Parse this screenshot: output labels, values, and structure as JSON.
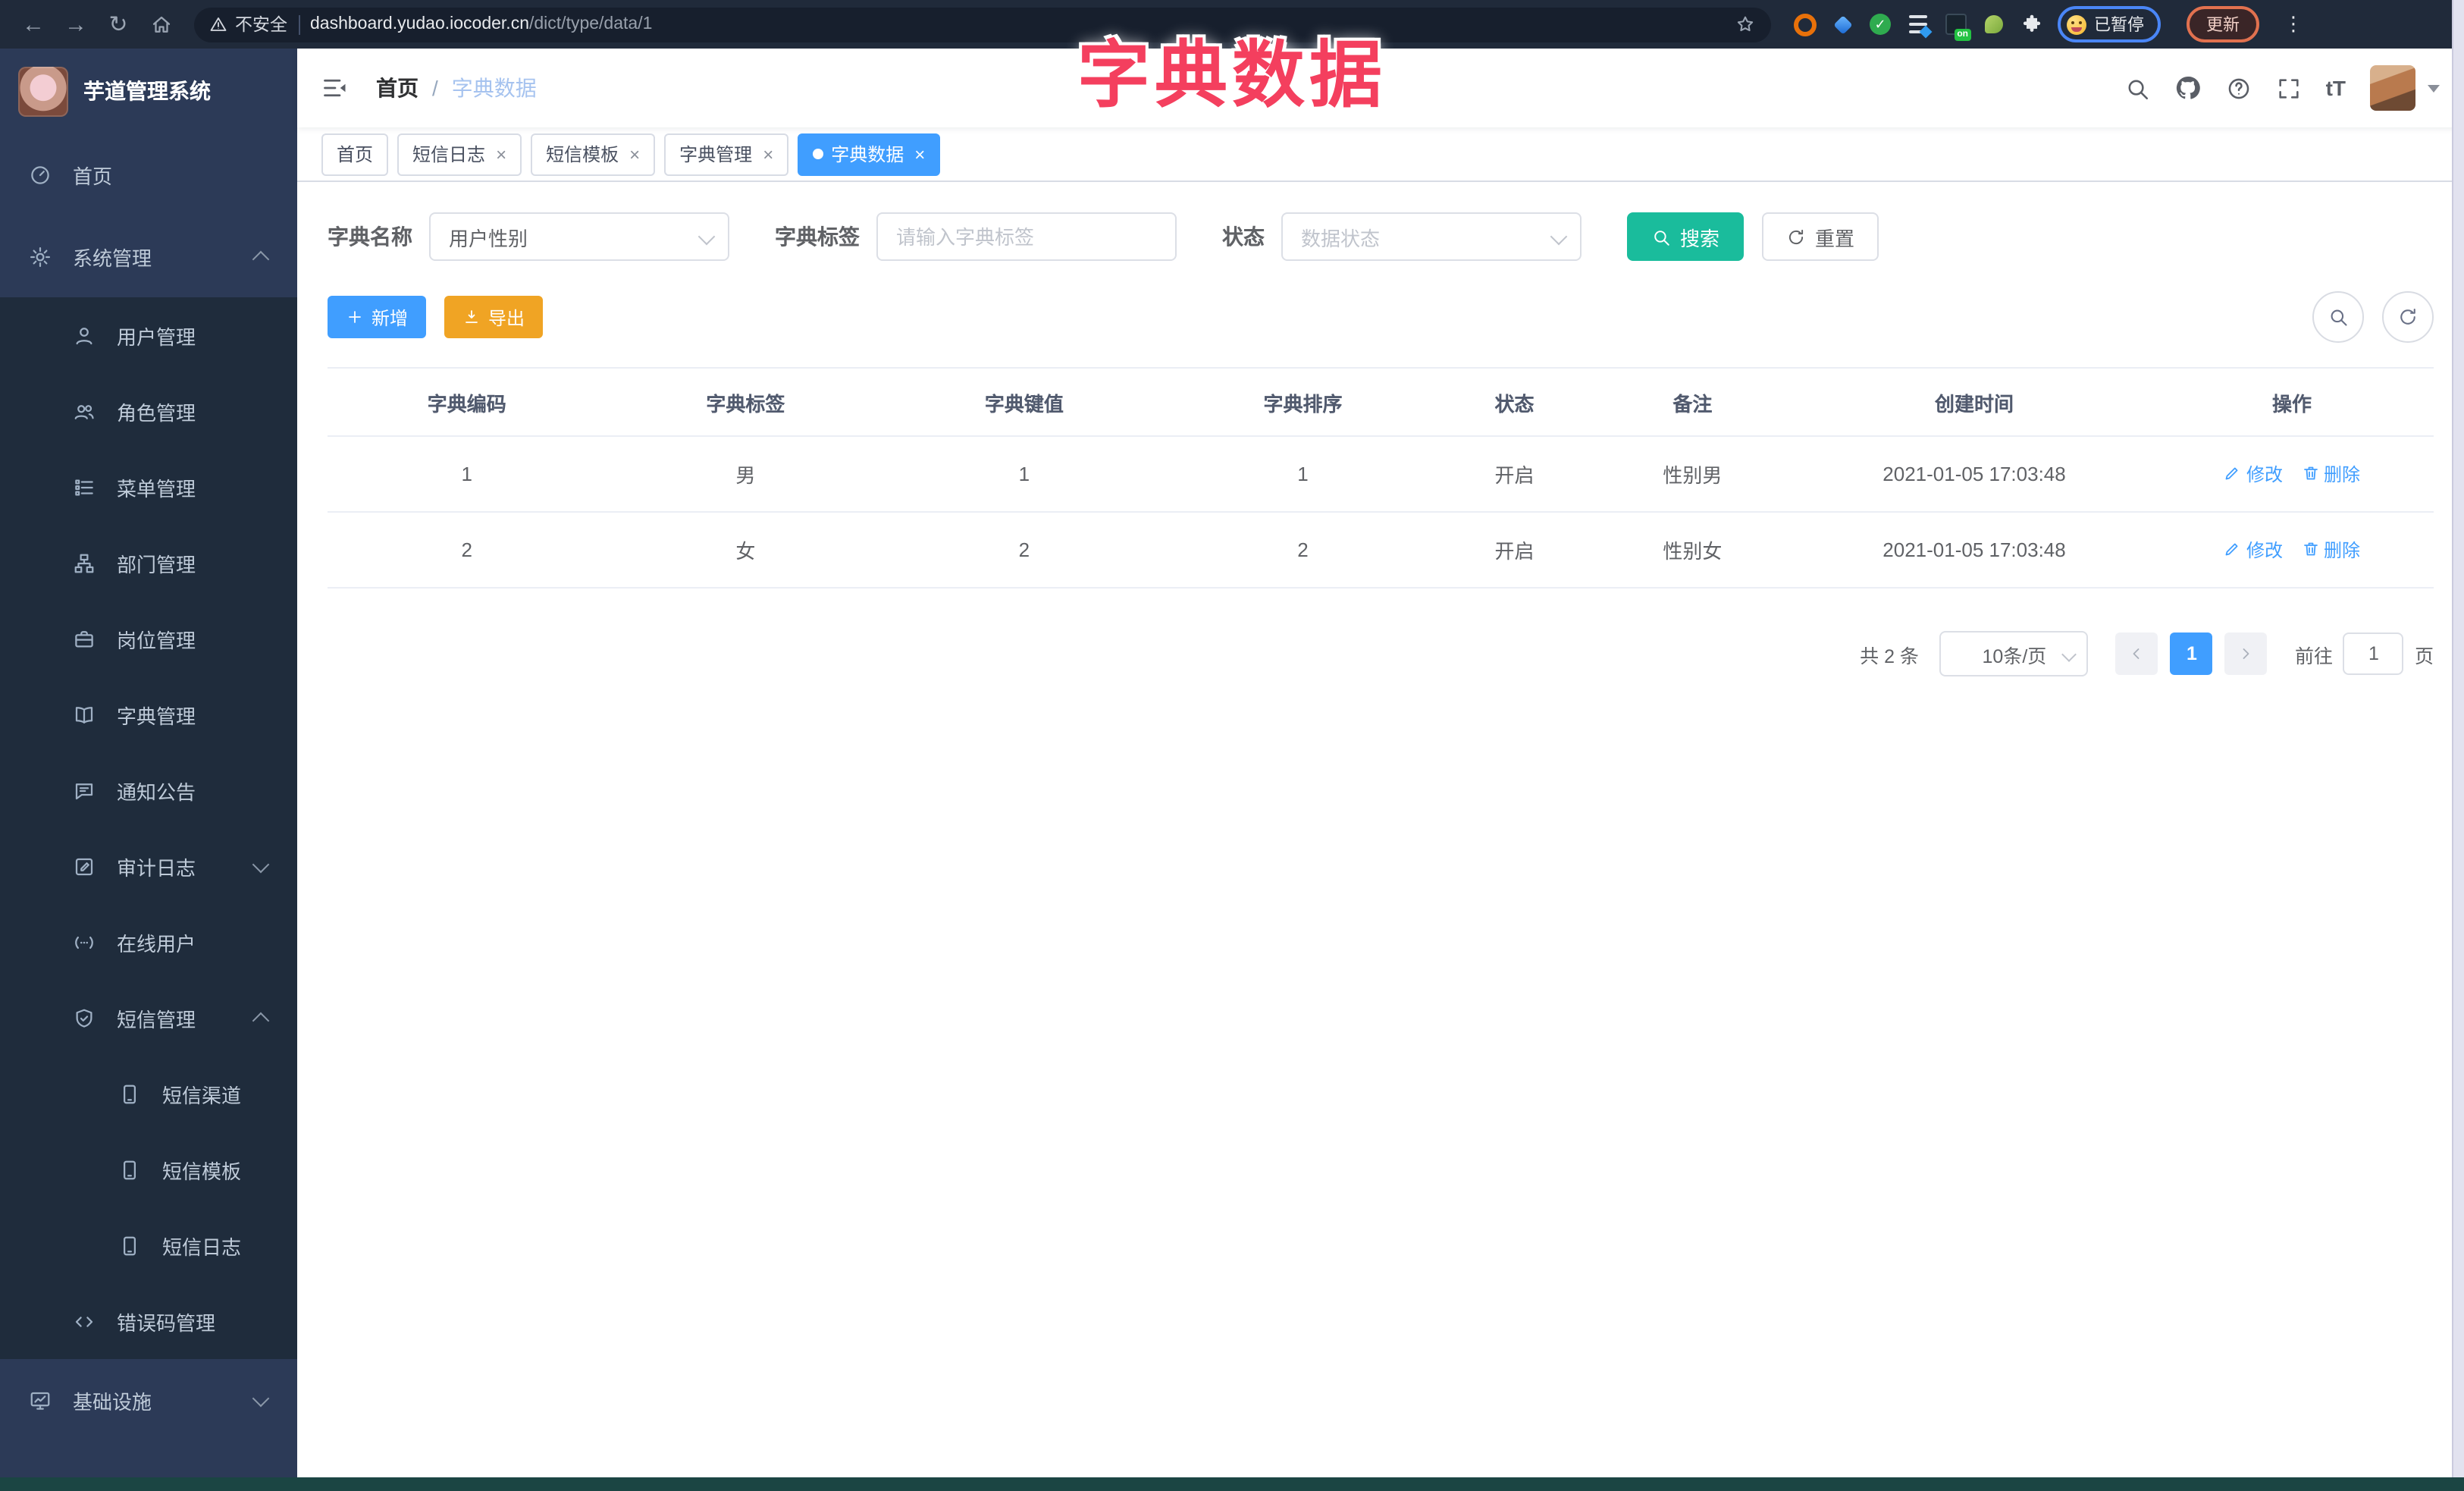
{
  "colors": {
    "accent": "#409EFF",
    "search_teal": "#1ABC9C",
    "export_orange": "#F0A424",
    "overlay_pink": "#F43F5E"
  },
  "browser": {
    "back_glyph": "←",
    "forward_glyph": "→",
    "reload_glyph": "↻",
    "security_label": "不安全",
    "url_domain": "dashboard.yudao.iocoder.cn",
    "url_path": "/dict/type/data/1",
    "on_badge": "on",
    "paused_label": "已暂停",
    "update_label": "更新",
    "menu_dots": "⋮"
  },
  "overlay_title": "字典数据",
  "sidebar": {
    "logo_title": "芋道管理系统",
    "items": [
      {
        "label": "首页",
        "icon": "dashboard-icon",
        "level": 1,
        "chevron": ""
      },
      {
        "label": "系统管理",
        "icon": "gear-icon",
        "level": 1,
        "chevron": "up"
      },
      {
        "label": "用户管理",
        "icon": "user-icon",
        "level": 2,
        "chevron": ""
      },
      {
        "label": "角色管理",
        "icon": "users-icon",
        "level": 2,
        "chevron": ""
      },
      {
        "label": "菜单管理",
        "icon": "menu-list-icon",
        "level": 2,
        "chevron": ""
      },
      {
        "label": "部门管理",
        "icon": "org-tree-icon",
        "level": 2,
        "chevron": ""
      },
      {
        "label": "岗位管理",
        "icon": "briefcase-icon",
        "level": 2,
        "chevron": ""
      },
      {
        "label": "字典管理",
        "icon": "book-icon",
        "level": 2,
        "chevron": ""
      },
      {
        "label": "通知公告",
        "icon": "announcement-icon",
        "level": 2,
        "chevron": ""
      },
      {
        "label": "审计日志",
        "icon": "audit-log-icon",
        "level": 2,
        "chevron": "down"
      },
      {
        "label": "在线用户",
        "icon": "online-user-icon",
        "level": 2,
        "chevron": ""
      },
      {
        "label": "短信管理",
        "icon": "shield-check-icon",
        "level": 2,
        "chevron": "up"
      },
      {
        "label": "短信渠道",
        "icon": "phone-icon",
        "level": 3,
        "chevron": ""
      },
      {
        "label": "短信模板",
        "icon": "phone-icon",
        "level": 3,
        "chevron": ""
      },
      {
        "label": "短信日志",
        "icon": "phone-icon",
        "level": 3,
        "chevron": ""
      },
      {
        "label": "错误码管理",
        "icon": "code-icon",
        "level": 2,
        "chevron": ""
      },
      {
        "label": "基础设施",
        "icon": "monitor-icon",
        "level": 1,
        "chevron": "down"
      }
    ]
  },
  "header": {
    "breadcrumb": [
      "首页",
      "字典数据"
    ],
    "breadcrumb_sep": "/",
    "font_size_label": "tT"
  },
  "tabs": [
    {
      "label": "首页",
      "closable": false,
      "active": false
    },
    {
      "label": "短信日志",
      "closable": true,
      "active": false
    },
    {
      "label": "短信模板",
      "closable": true,
      "active": false
    },
    {
      "label": "字典管理",
      "closable": true,
      "active": false
    },
    {
      "label": "字典数据",
      "closable": true,
      "active": true
    }
  ],
  "filters": {
    "dict_name_label": "字典名称",
    "dict_name_value": "用户性别",
    "dict_label_label": "字典标签",
    "dict_label_placeholder": "请输入字典标签",
    "status_label": "状态",
    "status_placeholder": "数据状态",
    "search_label": "搜索",
    "reset_label": "重置"
  },
  "toolbar": {
    "add_label": "新增",
    "export_label": "导出"
  },
  "table": {
    "columns": [
      "字典编码",
      "字典标签",
      "字典键值",
      "字典排序",
      "状态",
      "备注",
      "创建时间",
      "操作"
    ],
    "rows": [
      {
        "cells": [
          "1",
          "男",
          "1",
          "1",
          "开启",
          "性别男",
          "2021-01-05 17:03:48"
        ]
      },
      {
        "cells": [
          "2",
          "女",
          "2",
          "2",
          "开启",
          "性别女",
          "2021-01-05 17:03:48"
        ]
      }
    ],
    "edit_label": "修改",
    "delete_label": "删除"
  },
  "pagination": {
    "total_label": "共 2 条",
    "page_size_label": "10条/页",
    "page": "1",
    "goto_label": "前往",
    "goto_value": "1",
    "page_suffix": "页"
  }
}
